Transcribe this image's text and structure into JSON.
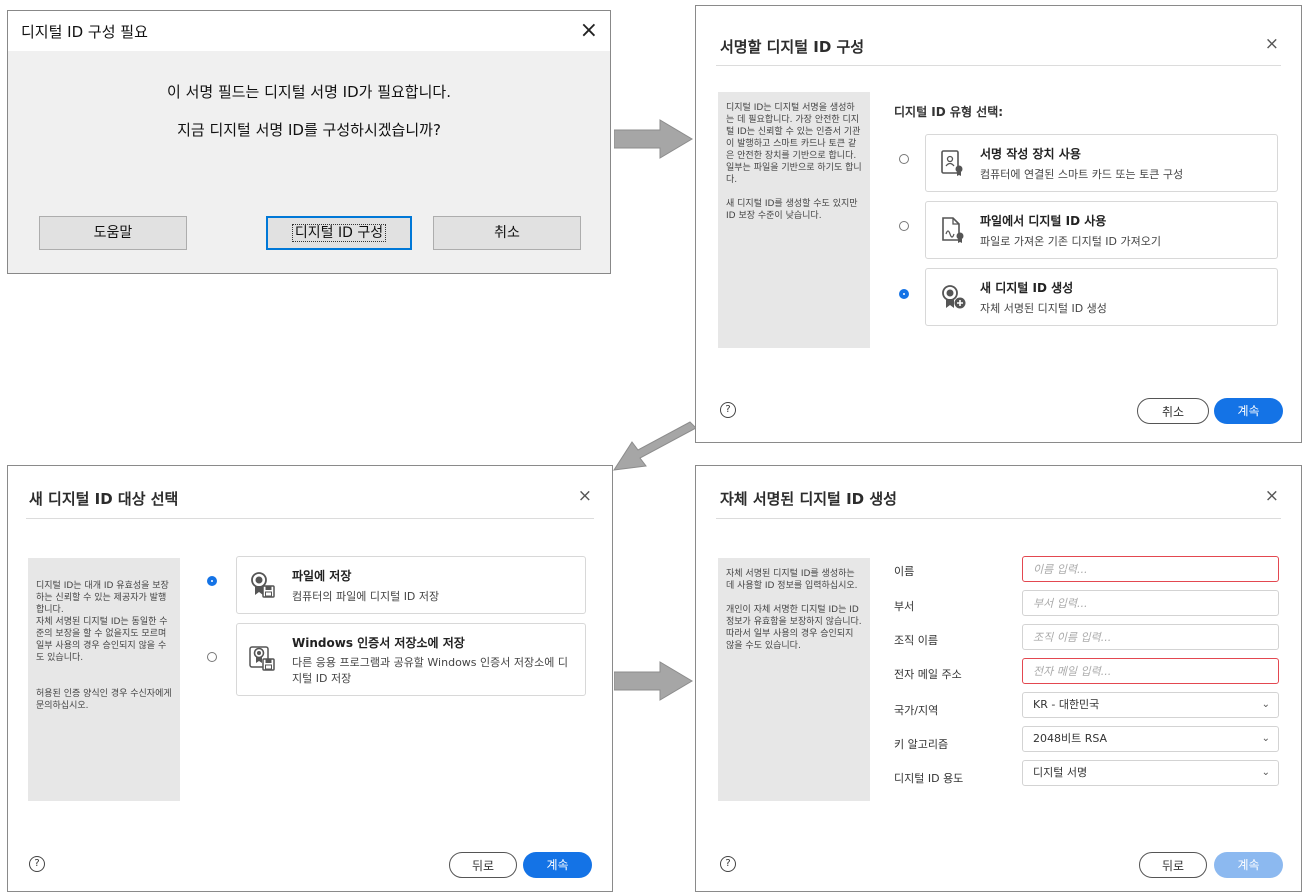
{
  "windows_dialog": {
    "title": "디지털 ID 구성 필요",
    "line1": "이 서명 필드는 디지털 서명 ID가 필요합니다.",
    "line2": "지금 디지털 서명 ID를 구성하시겠습니까?",
    "btn_help": "도움말",
    "btn_setup": "디지털 ID 구성",
    "btn_cancel": "취소"
  },
  "dialog_configure": {
    "title": "서명할 디지털 ID 구성",
    "sidebar_p1": "디지털 ID는 디지털 서명을 생성하는 데 필요합니다. 가장 안전한 디지털 ID는 신뢰할 수 있는 인증서 기관이 발행하고 스마트 카드나 토큰 같은 안전한 장치를 기반으로 합니다. 일부는 파일을 기반으로 하기도 합니다.",
    "sidebar_p2": "새 디지털 ID를 생성할 수도 있지만 ID 보장 수준이 낮습니다.",
    "heading": "디지털 ID 유형 선택:",
    "options": [
      {
        "title": "서명 작성 장치 사용",
        "desc": "컴퓨터에 연결된 스마트 카드 또는 토큰 구성",
        "selected": false,
        "icon": "smart-card-icon"
      },
      {
        "title": "파일에서 디지털 ID 사용",
        "desc": "파일로 가져온 기존 디지털 ID 가져오기",
        "selected": false,
        "icon": "file-certificate-icon"
      },
      {
        "title": "새 디지털 ID 생성",
        "desc": "자체 서명된 디지털 ID 생성",
        "selected": true,
        "icon": "new-certificate-icon"
      }
    ],
    "btn_cancel": "취소",
    "btn_continue": "계속"
  },
  "dialog_destination": {
    "title": "새 디지털 ID 대상 선택",
    "sidebar_p1": "디지털 ID는 대개 ID 유효성을 보장하는 신뢰할 수 있는 제공자가 발행합니다.\n자체 서명된 디지털 ID는 동일한 수준의 보장을 할 수 없을지도 모르며 일부 사용의 경우 승인되지 않을 수도 있습니다.",
    "sidebar_p2": "허용된 인증 양식인 경우 수신자에게 문의하십시오.",
    "options": [
      {
        "title": "파일에 저장",
        "desc": "컴퓨터의 파일에 디지털 ID 저장",
        "selected": true,
        "icon": "certificate-save-icon"
      },
      {
        "title": "Windows 인증서 저장소에 저장",
        "desc": "다른 응용 프로그램과 공유할 Windows 인증서 저장소에 디지털 ID 저장",
        "selected": false,
        "icon": "certificate-store-icon"
      }
    ],
    "btn_back": "뒤로",
    "btn_continue": "계속"
  },
  "dialog_create": {
    "title": "자체 서명된 디지털 ID 생성",
    "sidebar_p1": "자체 서명된 디지털 ID를 생성하는 데 사용할 ID 정보를 입력하십시오.",
    "sidebar_p2": "개인이 자체 서명한 디지털 ID는 ID 정보가 유효함을 보장하지 않습니다. 따라서 일부 사용의 경우 승인되지 않을 수도 있습니다.",
    "fields": [
      {
        "label": "이름",
        "placeholder": "이름 입력...",
        "error": true
      },
      {
        "label": "부서",
        "placeholder": "부서 입력...",
        "error": false
      },
      {
        "label": "조직 이름",
        "placeholder": "조직 이름 입력...",
        "error": false
      },
      {
        "label": "전자 메일 주소",
        "placeholder": "전자 메일 입력...",
        "error": true
      }
    ],
    "selects": [
      {
        "label": "국가/지역",
        "value": "KR - 대한민국"
      },
      {
        "label": "키 알고리즘",
        "value": "2048비트 RSA"
      },
      {
        "label": "디지털 ID 용도",
        "value": "디지털 서명"
      }
    ],
    "btn_back": "뒤로",
    "btn_continue": "계속"
  },
  "close_glyph": "×",
  "help_glyph": "?",
  "chevron_glyph": "⌄",
  "colors": {
    "accent": "#1473e6",
    "accent_disabled": "#8cb9f0",
    "error": "#e34850",
    "arrow": "#a6a6a6"
  }
}
